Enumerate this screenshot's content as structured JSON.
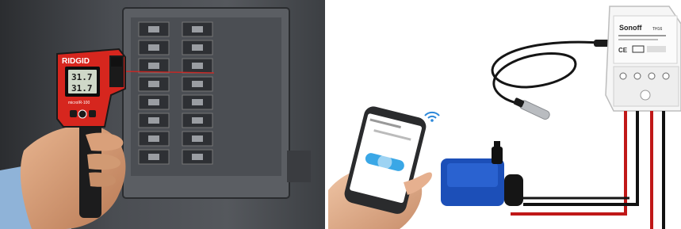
{
  "left_photo": {
    "thermometer_brand": "RIDGID",
    "reading_top": "31.7",
    "reading_bottom": "31.7",
    "model_text": "microIR-100",
    "laser_color": "#e0201c",
    "body_color": "#d6261e"
  },
  "right_photo": {
    "device_brand": "Sonoff",
    "device_model": "TH16",
    "ce_mark": "CE",
    "wire_colors": [
      "#c01818",
      "#111111",
      "#c01818",
      "#111111"
    ],
    "pump_color": "#1c4fb8",
    "app_screen_color": "#ffffff",
    "app_button_color": "#3aa7e6"
  }
}
